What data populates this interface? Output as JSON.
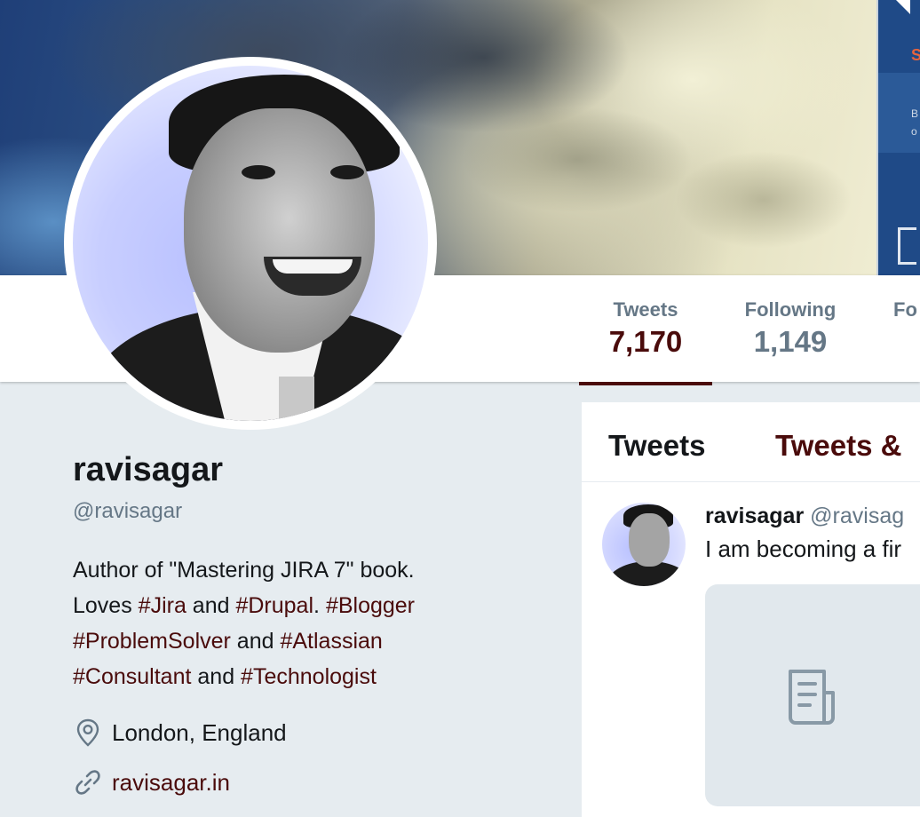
{
  "banner": {
    "side_text_1": "S",
    "side_text_2": "B",
    "side_text_3": "o"
  },
  "profile": {
    "name": "ravisagar",
    "handle": "@ravisagar",
    "bio": {
      "line1": "Author of \"Mastering JIRA 7\" book.",
      "line2_prefix": "Loves ",
      "line2_tag1": "#Jira",
      "line2_mid": " and ",
      "line2_tag2": "#Drupal",
      "line2_dot": ". ",
      "line2_tag3": "#Blogger",
      "line3_tag1": "#ProblemSolver",
      "line3_mid": " and ",
      "line3_tag2": "#Atlassian",
      "line4_tag1": "#Consultant",
      "line4_mid": " and ",
      "line4_tag2": "#Technologist"
    },
    "location": "London, England",
    "website": "ravisagar.in",
    "location_icon": "location-pin-icon",
    "link_icon": "link-icon"
  },
  "stats": {
    "tweets_label": "Tweets",
    "tweets_value": "7,170",
    "following_label": "Following",
    "following_value": "1,149",
    "followers_label": "Fo",
    "followers_value": "-"
  },
  "timeline": {
    "tabs": [
      "Tweets",
      "Tweets &"
    ],
    "tweet": {
      "name": "ravisagar",
      "handle": "@ravisag",
      "text": "I am becoming a fir",
      "card_icon": "document-icon"
    }
  },
  "colors": {
    "accent": "#4a0b0b",
    "secondary_text": "#657786",
    "background": "#e6ecf0"
  }
}
